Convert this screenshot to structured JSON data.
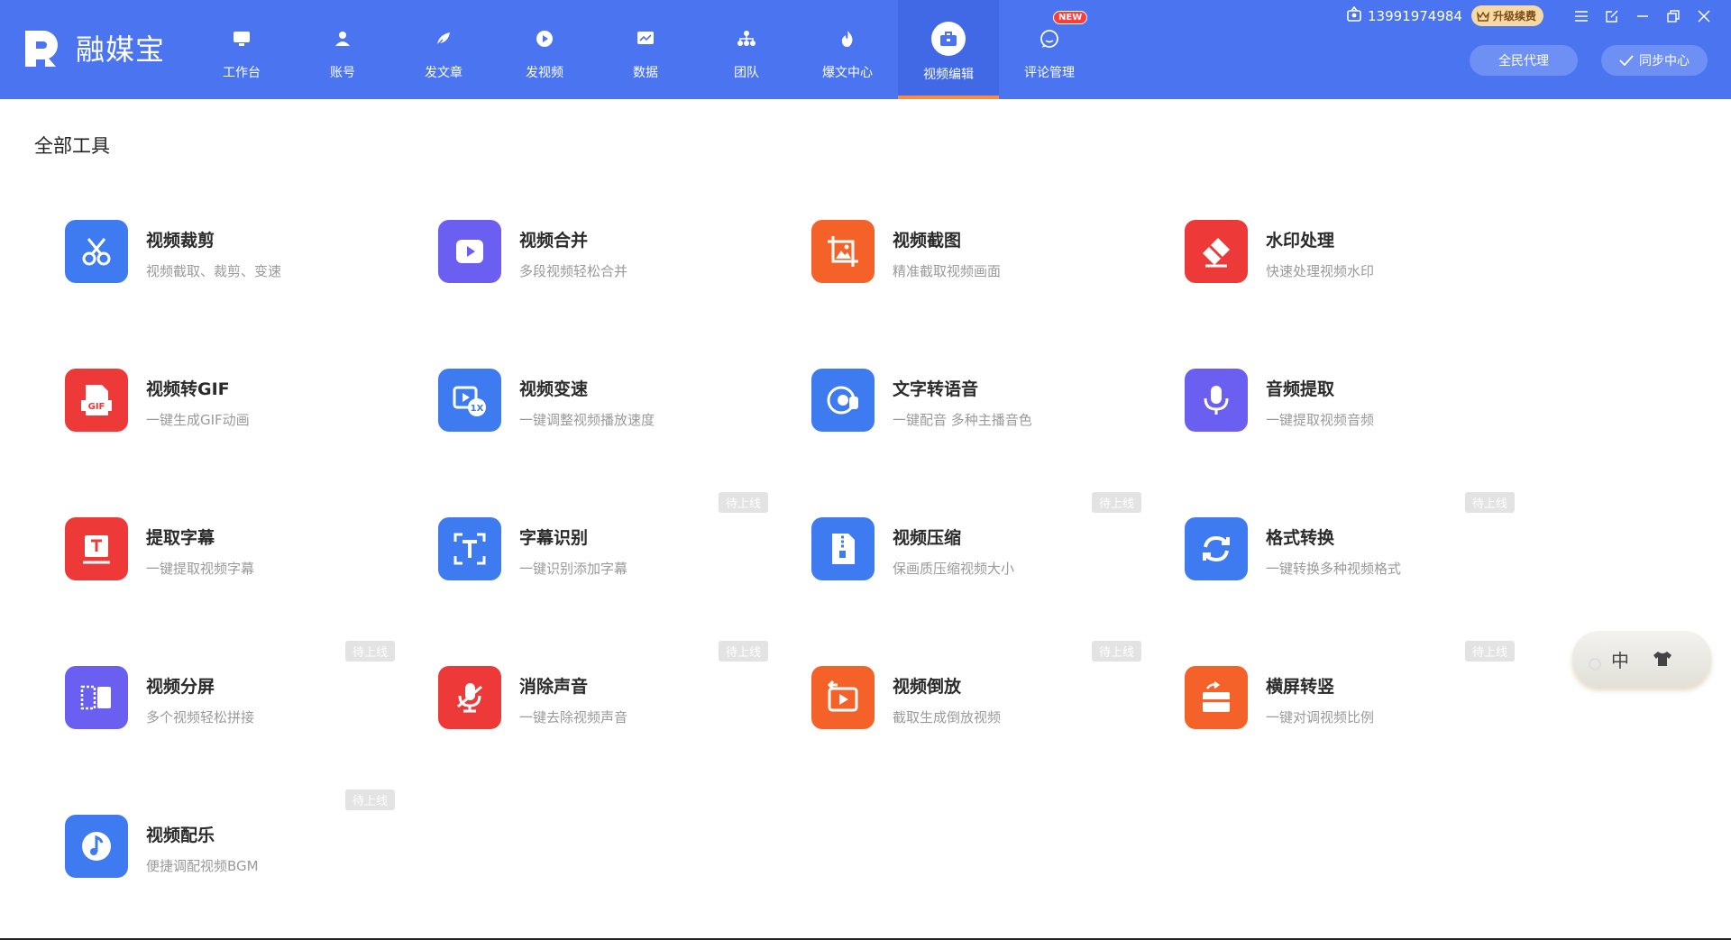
{
  "app": {
    "name": "融媒宝"
  },
  "nav": [
    {
      "label": "工作台",
      "icon": "monitor-icon"
    },
    {
      "label": "账号",
      "icon": "user-icon"
    },
    {
      "label": "发文章",
      "icon": "feather-icon"
    },
    {
      "label": "发视频",
      "icon": "play-icon"
    },
    {
      "label": "数据",
      "icon": "chart-icon"
    },
    {
      "label": "团队",
      "icon": "team-icon"
    },
    {
      "label": "爆文中心",
      "icon": "flame-icon"
    },
    {
      "label": "视频编辑",
      "icon": "toolbox-icon",
      "active": true
    },
    {
      "label": "评论管理",
      "icon": "comment-icon",
      "badge": "NEW"
    }
  ],
  "top_right": {
    "phone": "13991974984",
    "upgrade_label": "升级续费",
    "agent_label": "全民代理",
    "sync_label": "同步中心"
  },
  "section_title": "全部工具",
  "soon_label": "待上线",
  "tools": [
    {
      "name": "视频裁剪",
      "desc": "视频截取、裁剪、变速",
      "color": "#3e7bf0",
      "icon": "scissors-icon",
      "soon": false
    },
    {
      "name": "视频合并",
      "desc": "多段视频轻松合并",
      "color": "#6b5ff2",
      "icon": "video-merge-icon",
      "soon": false
    },
    {
      "name": "视频截图",
      "desc": "精准截取视频画面",
      "color": "#f4622a",
      "icon": "screenshot-icon",
      "soon": false
    },
    {
      "name": "水印处理",
      "desc": "快速处理视频水印",
      "color": "#ee3939",
      "icon": "eraser-icon",
      "soon": false
    },
    {
      "name": "视频转GIF",
      "desc": "一键生成GIF动画",
      "color": "#ee3939",
      "icon": "gif-icon",
      "soon": false
    },
    {
      "name": "视频变速",
      "desc": "一键调整视频播放速度",
      "color": "#3e7bf0",
      "icon": "speed-icon",
      "soon": false
    },
    {
      "name": "文字转语音",
      "desc": "一键配音 多种主播音色",
      "color": "#3e7bf0",
      "icon": "tts-icon",
      "soon": false
    },
    {
      "name": "音频提取",
      "desc": "一键提取视频音频",
      "color": "#6b5ff2",
      "icon": "microphone-icon",
      "soon": false
    },
    {
      "name": "提取字幕",
      "desc": "一键提取视频字幕",
      "color": "#ee3939",
      "icon": "subtitle-extract-icon",
      "soon": false
    },
    {
      "name": "字幕识别",
      "desc": "一键识别添加字幕",
      "color": "#3e7bf0",
      "icon": "text-recognize-icon",
      "soon": true
    },
    {
      "name": "视频压缩",
      "desc": "保画质压缩视频大小",
      "color": "#3e7bf0",
      "icon": "zip-icon",
      "soon": true
    },
    {
      "name": "格式转换",
      "desc": "一键转换多种视频格式",
      "color": "#3e7bf0",
      "icon": "convert-icon",
      "soon": true
    },
    {
      "name": "视频分屏",
      "desc": "多个视频轻松拼接",
      "color": "#6b5ff2",
      "icon": "split-screen-icon",
      "soon": true
    },
    {
      "name": "消除声音",
      "desc": "一键去除视频声音",
      "color": "#ee3939",
      "icon": "mute-mic-icon",
      "soon": true
    },
    {
      "name": "视频倒放",
      "desc": "截取生成倒放视频",
      "color": "#f4622a",
      "icon": "reverse-icon",
      "soon": true
    },
    {
      "name": "横屏转竖",
      "desc": "一键对调视频比例",
      "color": "#f4622a",
      "icon": "rotate-screen-icon",
      "soon": true
    },
    {
      "name": "视频配乐",
      "desc": "便捷调配视频BGM",
      "color": "#3e7bf0",
      "icon": "music-icon",
      "soon": true
    }
  ],
  "ime": {
    "label": "中"
  }
}
